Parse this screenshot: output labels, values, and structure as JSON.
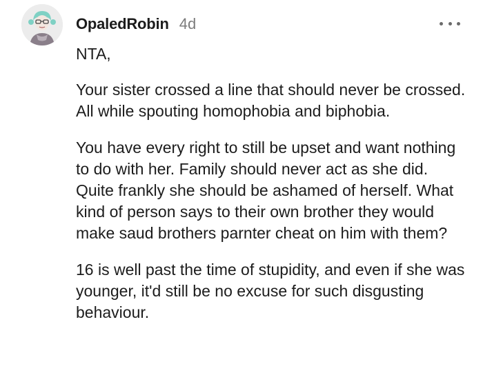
{
  "comment": {
    "author": "OpaledRobin",
    "age": "4d",
    "paragraphs": [
      "NTA,",
      "Your sister crossed a line that should never be crossed. All while spouting homophobia and biphobia.",
      "You have every right to still be upset and want nothing to do with her. Family should never act as she did. Quite frankly she should be ashamed of herself. What kind of person says to their own brother they would make saud brothers parnter cheat on him with them?",
      "16 is well past the time of stupidity, and even if she was younger, it'd still be no excuse for such disgusting behaviour."
    ]
  },
  "icons": {
    "more_menu": "more-horizontal-icon",
    "avatar": "user-avatar"
  },
  "colors": {
    "text": "#1c1c1c",
    "muted": "#7c7c7c"
  }
}
